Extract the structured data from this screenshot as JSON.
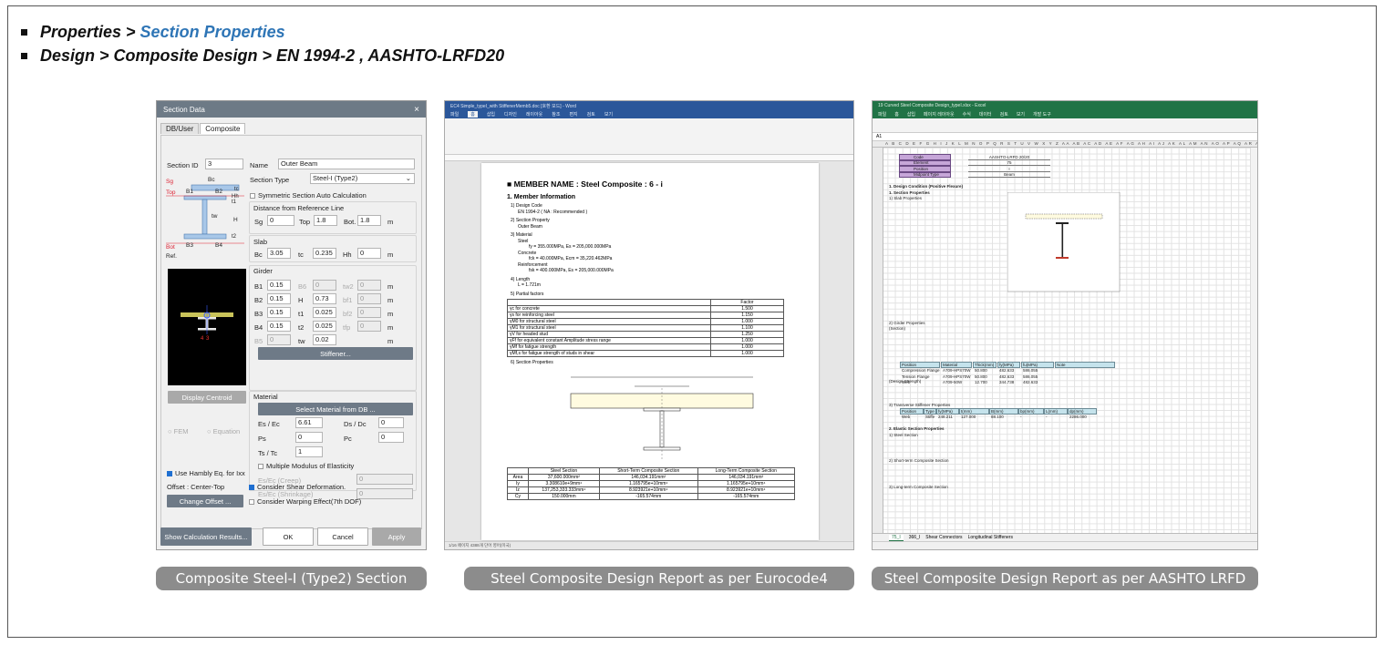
{
  "bullets": [
    {
      "prefix": "Properties > ",
      "highlight": "Section Properties"
    },
    {
      "prefix": "Design > Composite Design > EN 1994-2 ,  AASHTO-LRFD20",
      "highlight": ""
    }
  ],
  "captions": [
    "Composite Steel-I (Type2) Section",
    "Steel Composite Design Report as per Eurocode4",
    "Steel Composite Design Report as per AASHTO LRFD"
  ],
  "section_dialog": {
    "title": "Section Data",
    "tabs": [
      "DB/User",
      "Composite"
    ],
    "section_id_label": "Section ID",
    "section_id": "3",
    "name_label": "Name",
    "name": "Outer Beam",
    "section_type_label": "Section Type",
    "section_type": "Steel-I (Type2)",
    "symmetric_label": "Symmetric Section Auto Calculation",
    "distance_label": "Distance from Reference Line",
    "sg_label": "Sg",
    "sg": "0",
    "top_label": "Top",
    "top": "1.8",
    "bot_label": "Bot.",
    "bot": "1.8",
    "unit": "m",
    "slab_label": "Slab",
    "bc_label": "Bc",
    "bc": "3.05",
    "tc_label": "tc",
    "tc": "0.235",
    "hh_label": "Hh",
    "hh": "0",
    "girder_label": "Girder",
    "girder_rows": [
      {
        "l1": "B1",
        "v1": "0.15",
        "l2": "B6",
        "v2": "0",
        "l3": "tw2",
        "v3": "0"
      },
      {
        "l1": "B2",
        "v1": "0.15",
        "l2": "H",
        "v2": "0.73",
        "l3": "bf1",
        "v3": "0"
      },
      {
        "l1": "B3",
        "v1": "0.15",
        "l2": "t1",
        "v2": "0.025",
        "l3": "bf2",
        "v3": "0"
      },
      {
        "l1": "B4",
        "v1": "0.15",
        "l2": "t2",
        "v2": "0.025",
        "l3": "tfp",
        "v3": "0"
      },
      {
        "l1": "B5",
        "v1": "0",
        "l2": "tw",
        "v2": "0.02",
        "l3": "",
        "v3": ""
      }
    ],
    "stiffener_button": "Stiffener...",
    "material_label": "Material",
    "select_material_button": "Select Material from DB ...",
    "es_ec_label": "Es / Ec",
    "es_ec": "6.61",
    "ds_dc_label": "Ds / Dc",
    "ds_dc": "0",
    "ps_label": "Ps",
    "ps": "0",
    "pc_label": "Pc",
    "pc": "0",
    "ts_tc_label": "Ts / Tc",
    "ts_tc": "1",
    "multiple_modulus_label": "Multiple Modulus of Elasticity",
    "creep_label": "Es/Ec (Creep)",
    "creep": "0",
    "shrinkage_label": "Es/Ec (Shrinkage)",
    "shrinkage": "0",
    "display_centroid_button": "Display Centroid",
    "fem_label": "FEM",
    "equation_label": "Equation",
    "hambly_label": "Use Hambly Eq. for Ixx",
    "consider_shear_label": "Consider Shear Deformation.",
    "offset_label": "Offset : Center-Top",
    "change_offset_button": "Change Offset ...",
    "warping_label": "Consider Warping Effect(7th DOF)",
    "show_calc_button": "Show Calculation Results...",
    "ok_button": "OK",
    "cancel_button": "Cancel",
    "apply_button": "Apply",
    "sketch_labels": {
      "sg": "Sg",
      "bc": "Bc",
      "top": "Top",
      "b1": "B1",
      "b2": "B2",
      "b3": "B3",
      "b4": "B4",
      "bot": "Bot",
      "ref": "Ref.",
      "tw": "tw",
      "h": "H",
      "tc": "tc",
      "hh": "Hh",
      "t1": "t1",
      "t2": "t2"
    }
  },
  "word_doc": {
    "title_bar": "EC4 Simple_typeI_with StiffenerMemb5.doc [호환 모드] - Word",
    "menu": [
      "파일",
      "홈",
      "삽입",
      "디자인",
      "레이아웃",
      "참조",
      "편지",
      "검토",
      "보기"
    ],
    "heading": "■ MEMBER NAME : Steel Composite : 6 - i",
    "section1": "1. Member Information",
    "lines": [
      {
        "t": "1) Design Code",
        "c": ""
      },
      {
        "t": "EN 1994-2 ( NA : Recommended )",
        "c": "i2"
      },
      {
        "t": "2) Section Property",
        "c": "gap"
      },
      {
        "t": "Outer Beam",
        "c": "i2"
      },
      {
        "t": "3) Material",
        "c": "gap"
      },
      {
        "t": "Steel",
        "c": "i2"
      },
      {
        "t": "fy = 355.000MPa, Es = 205,000.000MPa",
        "c": "i4"
      },
      {
        "t": "Concrete",
        "c": "i2"
      },
      {
        "t": "fck = 40.000MPa, Ecm = 35,220.462MPa",
        "c": "i4"
      },
      {
        "t": "Reinforcement",
        "c": "i2"
      },
      {
        "t": "fsk = 400.000MPa, Es = 205,000.000MPa",
        "c": "i4"
      },
      {
        "t": "4) Length",
        "c": "gap"
      },
      {
        "t": "L = 1.721m",
        "c": "i2"
      },
      {
        "t": "5) Partial factors",
        "c": "gap"
      }
    ],
    "factor_header": "Factor",
    "factors": [
      [
        "γc for concrete",
        "1.500"
      ],
      [
        "γs for reinforcing steel",
        "1.150"
      ],
      [
        "γM0 for structural steel",
        "1.000"
      ],
      [
        "γM1 for structural steel",
        "1.100"
      ],
      [
        "γV for headed stud",
        "1.250"
      ],
      [
        "γFf for equivalent constant Amplitude stress range",
        "1.000"
      ],
      [
        "γMf for fatigue strength",
        "1.000"
      ],
      [
        "γMf,s for fatigue strength of studs in shear",
        "1.000"
      ]
    ],
    "section_props_title": "6) Section Properties",
    "prop_headers": [
      "",
      "Steel Section",
      "Short-Term Composite Section",
      "Long-Term Composite Section"
    ],
    "prop_rows": [
      [
        "Area",
        "37,600.000mm²",
        "146,034.191mm²",
        "146,034.191mm²"
      ],
      [
        "Iy",
        "3.308610e+9mm⁴",
        "1.165795e+10mm⁴",
        "1.165795e+10mm⁴"
      ],
      [
        "Iz",
        "137,253,333.333mm⁴",
        "8.923921e+10mm⁴",
        "8.923921e+10mm⁴"
      ],
      [
        "Cy",
        "150.000mm",
        "-165.574mm",
        "-165.574mm"
      ]
    ],
    "status_text": "1/16 페이지   4388개 단어   영어(미국)"
  },
  "excel": {
    "title_bar": "19 Curved Steel Composite Design_typeI.xlsx - Excel",
    "menu": [
      "파일",
      "홈",
      "삽입",
      "페이지 레이아웃",
      "수식",
      "데이터",
      "검토",
      "보기",
      "개발 도구"
    ],
    "cell_ref": "A1",
    "info": [
      [
        "Code",
        "AASHTO-LRFD 20/20"
      ],
      [
        "Element",
        "75"
      ],
      [
        "Position",
        "I"
      ],
      [
        "Midpoint Type",
        "Beam"
      ]
    ],
    "sheet_tabs": [
      "75_I",
      "366_I",
      "Shear Connectors",
      "Longitudinal Stiffeners"
    ],
    "lines": [
      "1. Design Condition (Positive Flexure)",
      "1. Section Properties",
      "1) Slab Properties",
      "2) Girder Properties",
      "(Section)",
      "(Design Strength)",
      "3) Transverse Stiffener Properties",
      "2. Elastic Section Properties",
      "1) Steel Section",
      "2) Short-term Composite Section",
      "3) Long-term Composite Section"
    ],
    "girder_table_headers": [
      "Position",
      "Material",
      "Thick(mm)",
      "fy(MPa)",
      "fu(MPa)",
      "Note"
    ],
    "girder_table_rows": [
      [
        "Compression Flange",
        "A709-HPS70W",
        "50.800",
        "482.633",
        "586.055",
        ""
      ],
      [
        "Tension Flange",
        "A709-HPS70W",
        "50.800",
        "482.633",
        "586.055",
        ""
      ],
      [
        "Web",
        "A709-50W",
        "12.700",
        "344.738",
        "482.633",
        ""
      ]
    ],
    "stiff_headers": [
      "Position",
      "Type",
      "fy(MPa)",
      "t(mm)",
      "B(mm)",
      "bp(mm)",
      "L(mm)",
      "dp(mm)"
    ],
    "stiff_row": [
      "Web",
      "Stiffe",
      "248.211",
      "127.000",
      "88.100",
      "-",
      "-",
      "2286.000"
    ]
  }
}
